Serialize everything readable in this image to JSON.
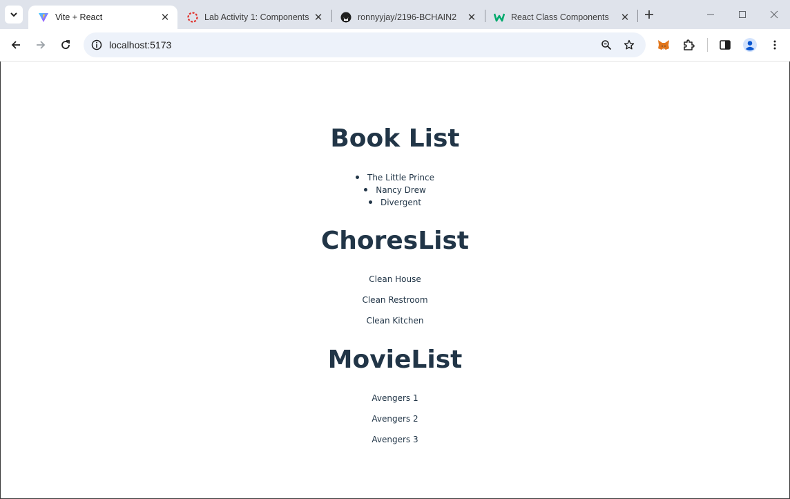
{
  "browser": {
    "tabs": [
      {
        "title": "Vite + React",
        "icon": "vite-icon",
        "active": true
      },
      {
        "title": "Lab Activity 1: Components",
        "icon": "lab-activity-icon",
        "active": false
      },
      {
        "title": "ronnyyjay/2196-BCHAIN2",
        "icon": "github-icon",
        "active": false
      },
      {
        "title": "React Class Components",
        "icon": "w3schools-icon",
        "active": false
      }
    ],
    "address": "localhost:5173"
  },
  "page": {
    "books": {
      "heading": "Book List",
      "items": [
        "The Little Prince",
        "Nancy Drew",
        "Divergent"
      ]
    },
    "chores": {
      "heading": "ChoresList",
      "items": [
        "Clean House",
        "Clean Restroom",
        "Clean Kitchen"
      ]
    },
    "movies": {
      "heading": "MovieList",
      "items": [
        "Avengers 1",
        "Avengers 2",
        "Avengers 3"
      ]
    }
  },
  "colors": {
    "heading": "#213547",
    "tabstrip": "#dfe3eb",
    "omnibox": "#edf2fa"
  }
}
